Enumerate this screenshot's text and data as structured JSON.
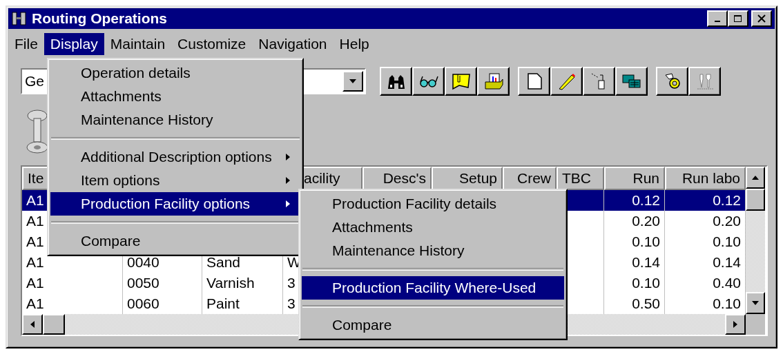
{
  "window": {
    "title": "Routing Operations"
  },
  "menubar": [
    {
      "label": "File",
      "selected": false
    },
    {
      "label": "Display",
      "selected": true
    },
    {
      "label": "Maintain",
      "selected": false
    },
    {
      "label": "Customize",
      "selected": false
    },
    {
      "label": "Navigation",
      "selected": false
    },
    {
      "label": "Help",
      "selected": false
    }
  ],
  "view_combo": {
    "value": "Ge"
  },
  "table": {
    "columns": [
      "Ite",
      null,
      null,
      "acility",
      "Desc's",
      "Setup",
      "Crew",
      "TBC",
      "Run",
      "Run labo"
    ],
    "rows": [
      {
        "selected": true,
        "cells": [
          "A1",
          null,
          null,
          null,
          null,
          null,
          null,
          null,
          "0.12",
          "0.12"
        ]
      },
      {
        "selected": false,
        "cells": [
          "A1",
          null,
          null,
          null,
          null,
          null,
          null,
          null,
          "0.20",
          "0.20"
        ]
      },
      {
        "selected": false,
        "cells": [
          "A1",
          null,
          null,
          null,
          null,
          null,
          null,
          null,
          "0.10",
          "0.10"
        ]
      },
      {
        "selected": false,
        "cells": [
          "A1",
          "0040",
          "Sand",
          "W",
          null,
          null,
          null,
          null,
          "0.14",
          "0.14"
        ]
      },
      {
        "selected": false,
        "cells": [
          "A1",
          "0050",
          "Varnish",
          "3",
          null,
          null,
          null,
          null,
          "0.10",
          "0.40"
        ]
      },
      {
        "selected": false,
        "cells": [
          "A1",
          "0060",
          "Paint",
          "3",
          null,
          null,
          null,
          null,
          "0.50",
          "0.10"
        ]
      }
    ]
  },
  "display_menu": [
    {
      "kind": "item",
      "label": "Operation details",
      "submenu": false,
      "selected": false
    },
    {
      "kind": "item",
      "label": "Attachments",
      "submenu": false,
      "selected": false
    },
    {
      "kind": "item",
      "label": "Maintenance History",
      "submenu": false,
      "selected": false
    },
    {
      "kind": "separator"
    },
    {
      "kind": "item",
      "label": "Additional Description options",
      "submenu": true,
      "selected": false
    },
    {
      "kind": "item",
      "label": "Item options",
      "submenu": true,
      "selected": false
    },
    {
      "kind": "item",
      "label": "Production Facility options",
      "submenu": true,
      "selected": true
    },
    {
      "kind": "separator"
    },
    {
      "kind": "item",
      "label": "Compare",
      "submenu": false,
      "selected": false
    }
  ],
  "facility_submenu": [
    {
      "kind": "item",
      "label": "Production Facility details",
      "submenu": false,
      "selected": false
    },
    {
      "kind": "item",
      "label": "Attachments",
      "submenu": false,
      "selected": false
    },
    {
      "kind": "item",
      "label": "Maintenance History",
      "submenu": false,
      "selected": false
    },
    {
      "kind": "separator"
    },
    {
      "kind": "item",
      "label": "Production Facility Where-Used",
      "submenu": false,
      "selected": true
    },
    {
      "kind": "separator"
    },
    {
      "kind": "item",
      "label": "Compare",
      "submenu": false,
      "selected": false
    }
  ]
}
